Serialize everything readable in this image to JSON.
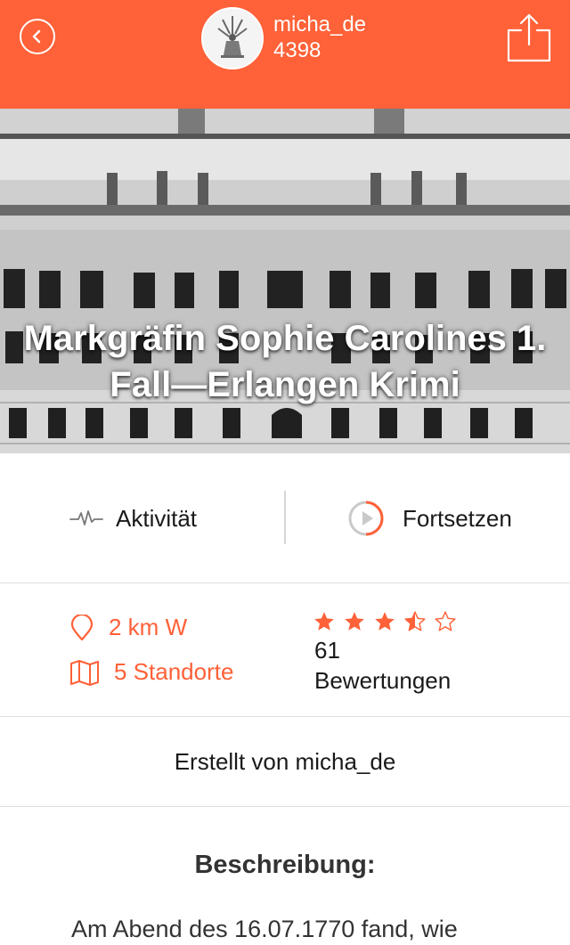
{
  "header": {
    "username": "micha_de",
    "points": "4398",
    "back_icon": "chevron-left-icon",
    "share_icon": "share-icon",
    "accent_color": "#ff6138"
  },
  "hero": {
    "title": "Markgräfin Sophie Carolines 1. Fall—Erlangen Krimi"
  },
  "actions": {
    "activity_label": "Aktivität",
    "activity_icon": "activity-pulse-icon",
    "continue_label": "Fortsetzen",
    "continue_icon": "play-circle-icon"
  },
  "info": {
    "distance": "2 km W",
    "distance_icon": "location-pin-icon",
    "locations": "5 Standorte",
    "locations_icon": "map-icon",
    "rating_value": 3.5,
    "rating_max": 5,
    "rating_count": "61",
    "rating_label": "Bewertungen"
  },
  "creator": {
    "text": "Erstellt von micha_de"
  },
  "description": {
    "title": "Beschreibung:",
    "text": "Am Abend des 16.07.1770 fand, wie"
  }
}
